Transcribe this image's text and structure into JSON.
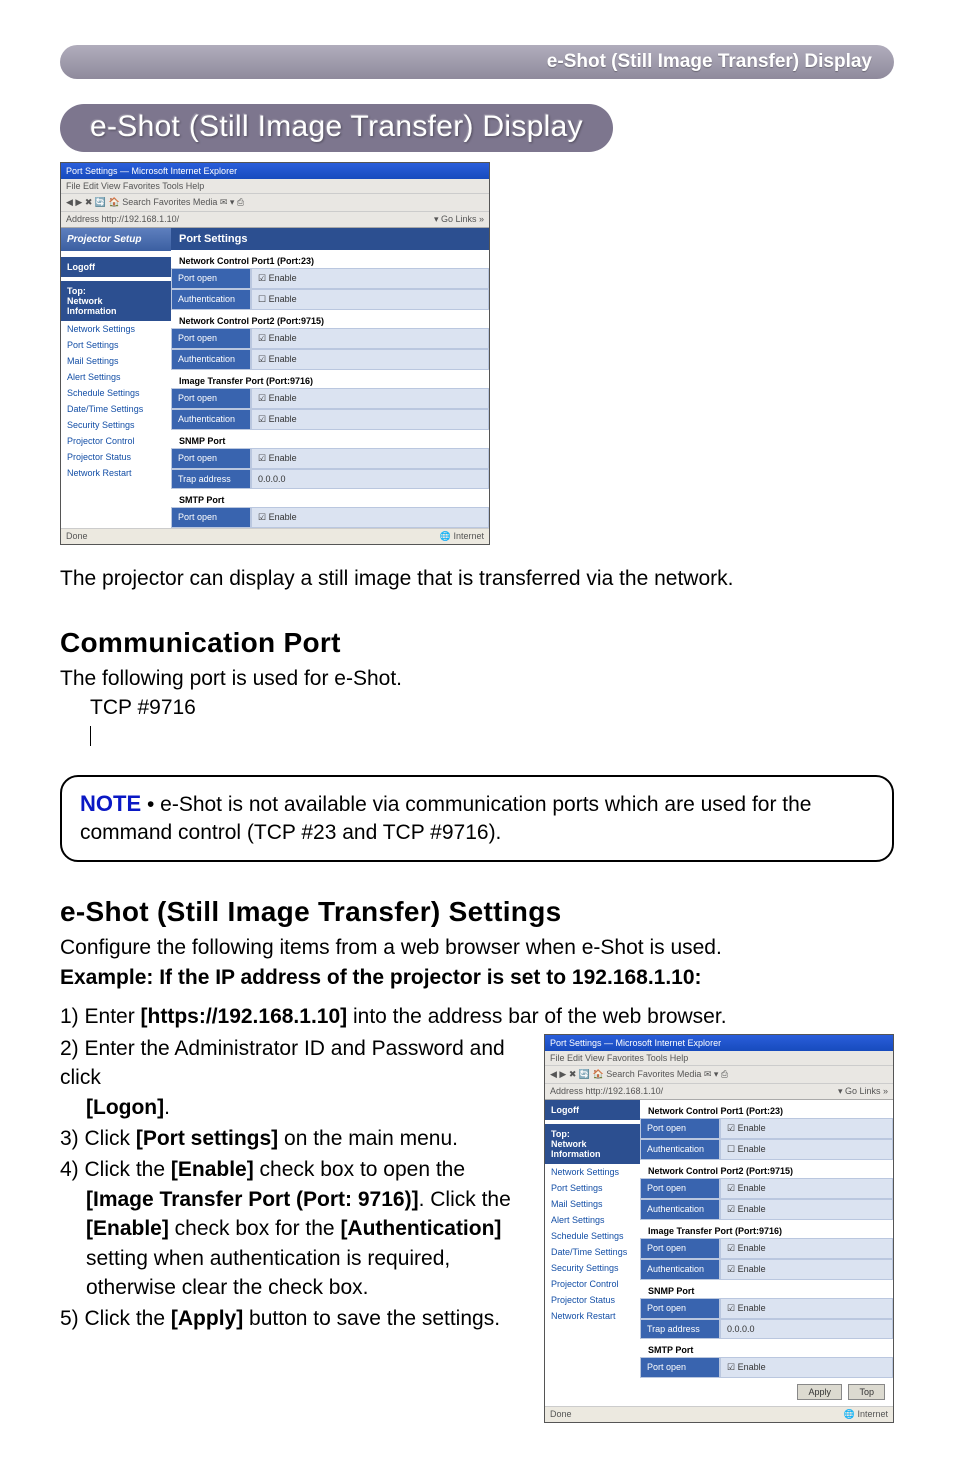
{
  "breadcrumb": {
    "text": "e-Shot (Still Image Transfer) Display"
  },
  "title": {
    "text": "e-Shot (Still Image Transfer) Display"
  },
  "screenshot1": {
    "titlebar": "Port Settings — Microsoft Internet Explorer",
    "menubar": "File  Edit  View  Favorites  Tools  Help",
    "toolbar": "◀ ▶ ✖ 🔄 🏠  Search  Favorites  Media  ✉ ▾ ⎙",
    "addrbar_left": "Address   http://192.168.1.10/",
    "addrbar_right": "▾ Go  Links »",
    "sidebar": {
      "top": "Projector Setup",
      "logoff": "Logoff",
      "block": "Top:\nNetwork\nInformation",
      "items": [
        "Network Settings",
        "Port Settings",
        "Mail Settings",
        "Alert Settings",
        "Schedule Settings",
        "Date/Time Settings",
        "Security Settings",
        "Projector Control",
        "Projector Status",
        "Network Restart"
      ]
    },
    "main": {
      "header": "Port Settings",
      "sections": [
        {
          "title": "Network Control Port1 (Port:23)",
          "rows": [
            {
              "label": "Port open",
              "value": "☑ Enable"
            },
            {
              "label": "Authentication",
              "value": "☐ Enable"
            }
          ]
        },
        {
          "title": "Network Control Port2 (Port:9715)",
          "rows": [
            {
              "label": "Port open",
              "value": "☑ Enable"
            },
            {
              "label": "Authentication",
              "value": "☑ Enable"
            }
          ]
        },
        {
          "title": "Image Transfer Port (Port:9716)",
          "rows": [
            {
              "label": "Port open",
              "value": "☑ Enable"
            },
            {
              "label": "Authentication",
              "value": "☑ Enable"
            }
          ]
        },
        {
          "title": "SNMP Port",
          "rows": [
            {
              "label": "Port open",
              "value": "☑ Enable"
            },
            {
              "label": "Trap address",
              "value": "0.0.0.0"
            }
          ]
        },
        {
          "title": "SMTP Port",
          "rows": [
            {
              "label": "Port open",
              "value": "☑ Enable"
            }
          ]
        }
      ]
    },
    "statusbar_left": "Done",
    "statusbar_right": "🌐 Internet"
  },
  "intro": {
    "text": "The projector can display a still image that is transferred via the network."
  },
  "commport": {
    "heading": "Communication Port",
    "line1": "The following port is used for e-Shot.",
    "line2": "TCP #9716"
  },
  "note": {
    "label": "NOTE",
    "text": " • e-Shot is not available via communication ports which are used for the command control (TCP #23 and TCP #9716)."
  },
  "settings": {
    "heading": "e-Shot (Still Image Transfer) Settings",
    "intro": "Configure the following items from a web browser when e-Shot is used.",
    "example": "Example: If the IP address of the projector is set to 192.168.1.10:",
    "step1a": "1) Enter ",
    "step1b": "[https://192.168.1.10]",
    "step1c": " into the address bar of the web browser.",
    "step2a": "2) Enter the Administrator ID and Password and click ",
    "step2b": "[Logon]",
    "step2c": ".",
    "step3a": "3) Click ",
    "step3b": "[Port settings]",
    "step3c": " on the main menu.",
    "step4a": "4) Click the ",
    "step4b": "[Enable]",
    "step4c": " check box to open the ",
    "step4d": "[Image Transfer Port (Port: 9716)]",
    "step4e": ". Click the ",
    "step4f": "[Enable]",
    "step4g": " check box for the ",
    "step4h": "[Authentication]",
    "step4i": " setting when authentication is required, otherwise clear the check box.",
    "step5a": "5) Click the ",
    "step5b": "[Apply]",
    "step5c": " button to save the settings."
  },
  "screenshot2": {
    "buttons": {
      "apply": "Apply",
      "top": "Top"
    }
  }
}
